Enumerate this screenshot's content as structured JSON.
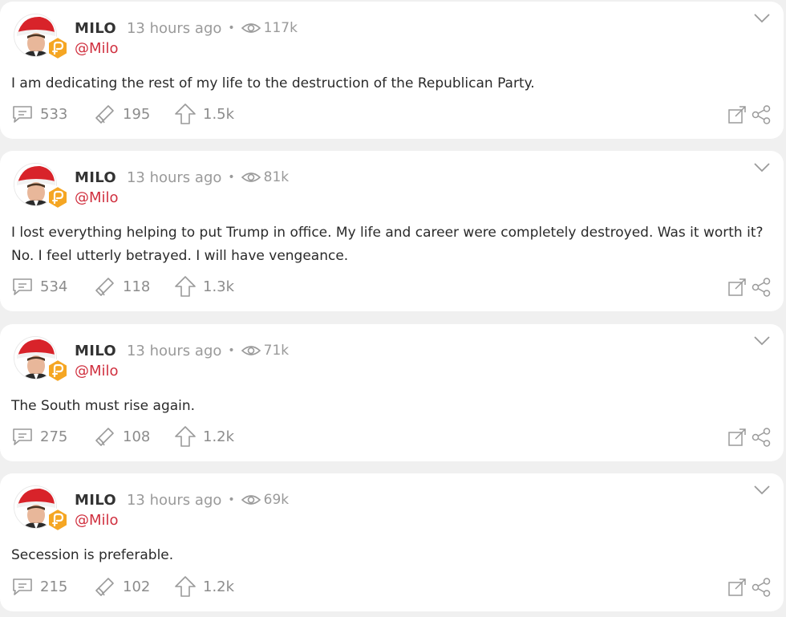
{
  "colors": {
    "accent_red": "#d0303f",
    "muted_gray": "#9a9a9a",
    "badge_orange": "#f5a623",
    "card_bg": "#ffffff",
    "page_bg": "#f0f0f0"
  },
  "icons": {
    "avatar": "profile-photo-santa-hat",
    "badge": "parler-hexagon-badge",
    "views": "eye-icon",
    "comments": "comment-bubble-icon",
    "echoes": "echo-megaphone-icon",
    "upvotes": "upvote-arrow-icon",
    "expand": "expand-icon",
    "share": "share-icon",
    "menu": "chevron-down-icon"
  },
  "posts": [
    {
      "author": "MILO",
      "handle": "@Milo",
      "time": "13 hours ago",
      "separator": "•",
      "views": "117k",
      "text": "I am dedicating the rest of my life to the destruction of the Republican Party.",
      "comments": "533",
      "echoes": "195",
      "upvotes": "1.5k"
    },
    {
      "author": "MILO",
      "handle": "@Milo",
      "time": "13 hours ago",
      "separator": "•",
      "views": "81k",
      "text": "I lost everything helping to put Trump in office. My life and career were completely destroyed. Was it worth it? No. I feel utterly betrayed. I will have vengeance.",
      "comments": "534",
      "echoes": "118",
      "upvotes": "1.3k"
    },
    {
      "author": "MILO",
      "handle": "@Milo",
      "time": "13 hours ago",
      "separator": "•",
      "views": "71k",
      "text": "The South must rise again.",
      "comments": "275",
      "echoes": "108",
      "upvotes": "1.2k"
    },
    {
      "author": "MILO",
      "handle": "@Milo",
      "time": "13 hours ago",
      "separator": "•",
      "views": "69k",
      "text": "Secession is preferable.",
      "comments": "215",
      "echoes": "102",
      "upvotes": "1.2k"
    }
  ]
}
